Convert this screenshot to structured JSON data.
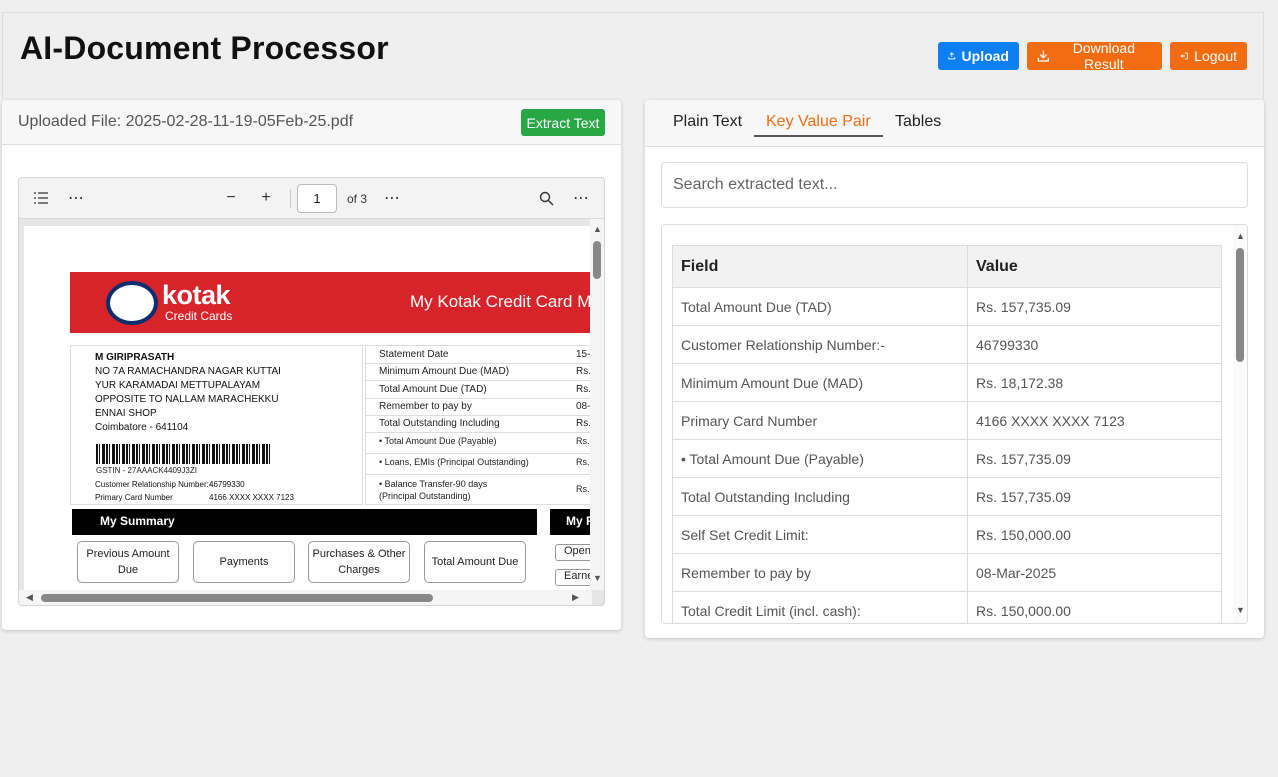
{
  "app": {
    "title": "AI-Document Processor",
    "upload_label": "Upload",
    "download_label": "Download Result",
    "logout_label": "Logout"
  },
  "left_panel": {
    "file_label": "Uploaded File: 2025-02-28-11-19-05Feb-25.pdf",
    "extract_label": "Extract Text",
    "viewer": {
      "page_number": "1",
      "page_total": "of 3"
    },
    "pdf": {
      "logo": "kotak",
      "logo_sub": "Credit Cards",
      "banner_title": "My Kotak Credit Card M",
      "address": [
        "M GIRIPRASATH",
        "NO 7A RAMACHANDRA NAGAR KUTTAI",
        "YUR KARAMADAI METTUPALAYAM",
        "OPPOSITE TO NALLAM MARACHEKKU",
        "ENNAI SHOP",
        "Coimbatore - 641104"
      ],
      "gstin": "GSTIN - 27AAACK4409J3ZI",
      "crn_label": "Customer Relationship Number:-",
      "crn_value": "46799330",
      "pcn_label": "Primary Card Number",
      "pcn_value": "4166 XXXX XXXX 7123",
      "statement_rows": [
        {
          "k": "Statement Date",
          "v": "15-"
        },
        {
          "k": "Minimum Amount Due (MAD)",
          "v": "Rs."
        },
        {
          "k": "Total Amount Due (TAD)",
          "v": "Rs."
        },
        {
          "k": "Remember to pay by",
          "v": "08-"
        },
        {
          "k": "Total Outstanding Including",
          "v": "Rs."
        },
        {
          "k": "• Total Amount Due (Payable)",
          "v": "Rs."
        },
        {
          "k": "• Loans, EMIs (Principal Outstanding)",
          "v": "Rs."
        },
        {
          "k": "• Balance Transfer-90 days (Principal Outstanding)",
          "v": "Rs."
        }
      ],
      "summary_title": "My Summary",
      "summary_title2": "My R",
      "summary_boxes": [
        "Previous Amount Due",
        "Payments",
        "Purchases & Other Charges",
        "Total Amount Due"
      ],
      "side_small": [
        "Open",
        "Earne"
      ]
    }
  },
  "right_panel": {
    "tabs": [
      "Plain Text",
      "Key Value Pair",
      "Tables"
    ],
    "active_tab": "Key Value Pair",
    "search_placeholder": "Search extracted text...",
    "table": {
      "headers": [
        "Field",
        "Value"
      ],
      "rows": [
        [
          "Total Amount Due (TAD)",
          "Rs. 157,735.09"
        ],
        [
          "Customer Relationship Number:-",
          "46799330"
        ],
        [
          "Minimum Amount Due (MAD)",
          "Rs. 18,172.38"
        ],
        [
          "Primary Card Number",
          "4166 XXXX XXXX 7123"
        ],
        [
          "• Total Amount Due (Payable)",
          "Rs. 157,735.09"
        ],
        [
          "Total Outstanding Including",
          "Rs. 157,735.09"
        ],
        [
          "Self Set Credit Limit:",
          "Rs. 150,000.00"
        ],
        [
          "Remember to pay by",
          "08-Mar-2025"
        ],
        [
          "Total Credit Limit (incl. cash):",
          "Rs. 150,000.00"
        ]
      ]
    }
  },
  "colors": {
    "upload": "#0d7ff4",
    "orange": "#f26c12",
    "green": "#27a844",
    "kotak_red": "#d8232a"
  }
}
